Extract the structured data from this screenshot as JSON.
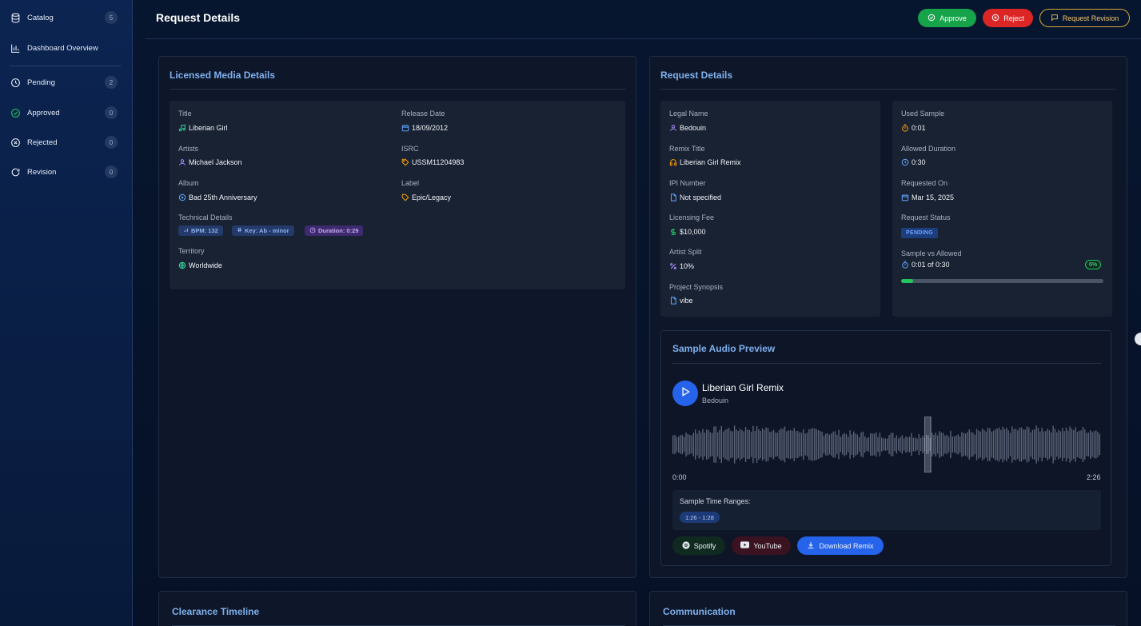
{
  "sidebar": {
    "items": [
      {
        "label": "Catalog",
        "count": "5"
      },
      {
        "label": "Dashboard Overview",
        "count": ""
      },
      {
        "label": "Pending",
        "count": "2"
      },
      {
        "label": "Approved",
        "count": "0"
      },
      {
        "label": "Rejected",
        "count": "0"
      },
      {
        "label": "Revision",
        "count": "0"
      }
    ]
  },
  "header": {
    "title": "Request Details",
    "approve_label": "Approve",
    "reject_label": "Reject",
    "revision_label": "Request Revision"
  },
  "media": {
    "card_title": "Licensed Media Details",
    "title_label": "Title",
    "title_value": "Liberian Girl",
    "release_label": "Release Date",
    "release_value": "18/09/2012",
    "artists_label": "Artists",
    "artists_value": "Michael Jackson",
    "isrc_label": "ISRC",
    "isrc_value": "USSM11204983",
    "album_label": "Album",
    "album_value": "Bad 25th Anniversary",
    "label_label": "Label",
    "label_value": "Epic/Legacy",
    "technical_label": "Technical Details",
    "bpm_chip": "BPM: 132",
    "key_chip": "Key: Ab - minor",
    "duration_chip": "Duration: 0:29",
    "territory_label": "Territory",
    "territory_value": "Worldwide"
  },
  "request": {
    "card_title": "Request Details",
    "legal_name_label": "Legal Name",
    "legal_name_value": "Bedouin",
    "remix_title_label": "Remix Title",
    "remix_title_value": "Liberian Girl Remix",
    "ipi_label": "IPI Number",
    "ipi_value": "Not specified",
    "fee_label": "Licensing Fee",
    "fee_value": "$10,000",
    "split_label": "Artist Split",
    "split_value": "10%",
    "synopsis_label": "Project Synopsis",
    "synopsis_value": "vibe",
    "used_sample_label": "Used Sample",
    "used_sample_value": "0:01",
    "allowed_label": "Allowed Duration",
    "allowed_value": "0:30",
    "requested_label": "Requested On",
    "requested_value": "Mar 15, 2025",
    "status_label": "Request Status",
    "status_value": "PENDING",
    "sample_vs_label": "Sample vs Allowed",
    "sample_vs_value": "0:01 of 0:30",
    "sample_pct_label": "6%",
    "sample_fraction": 0.06
  },
  "audio": {
    "card_title": "Sample Audio Preview",
    "track_title": "Liberian Girl Remix",
    "track_artist": "Bedouin",
    "time_start": "0:00",
    "time_end": "2:26",
    "ranges_label": "Sample Time Ranges:",
    "range_chip": "1:26 - 1:28",
    "spotify_label": "Spotify",
    "youtube_label": "YouTube",
    "download_label": "Download Remix"
  },
  "bottom": {
    "timeline_title": "Clearance Timeline",
    "communication_title": "Communication"
  },
  "colors": {
    "accent": "#7fb0ee",
    "approve": "#16a34a",
    "reject": "#dc2626",
    "revision": "#d9a53a",
    "primary": "#2563eb"
  }
}
